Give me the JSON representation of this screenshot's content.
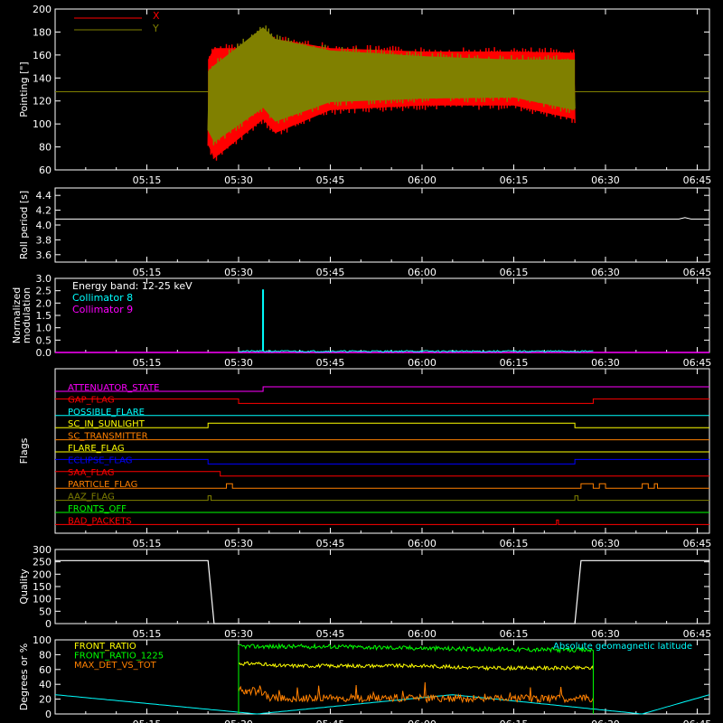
{
  "colors": {
    "background": "#000000",
    "axes": "#ffffff",
    "x": "#ff0000",
    "y": "#808000",
    "roll": "#ffffff",
    "collimator8": "#00ffff",
    "collimator9": "#ff00ff",
    "quality": "#ffffff",
    "front_ratio": "#ffff00",
    "front_ratio_1225": "#00ff00",
    "max_det": "#ff8000",
    "geomag": "#00ffff"
  },
  "time_ticks": [
    "05:15",
    "05:30",
    "05:45",
    "06:00",
    "06:15",
    "06:30",
    "06:45"
  ],
  "chart_data": [
    {
      "id": "pointing",
      "type": "line",
      "ylabel": "Pointing [\"]",
      "ylim": [
        60,
        200
      ],
      "yticks": [
        "60",
        "80",
        "100",
        "120",
        "140",
        "160",
        "180",
        "200"
      ],
      "legend": [
        "X",
        "Y"
      ],
      "series": [
        {
          "name": "X",
          "t": [
            "05:25",
            "05:26",
            "05:34",
            "05:36",
            "05:45",
            "06:00",
            "06:15",
            "06:25"
          ],
          "min": [
            78,
            66,
            100,
            88,
            108,
            112,
            112,
            100
          ],
          "max": [
            160,
            170,
            170,
            178,
            170,
            167,
            167,
            166
          ]
        },
        {
          "name": "Y",
          "t": [
            "05:25",
            "05:26",
            "05:34",
            "05:36",
            "05:45",
            "06:00",
            "06:15",
            "06:25"
          ],
          "min": [
            90,
            80,
            110,
            98,
            115,
            118,
            119,
            108
          ],
          "max": [
            150,
            155,
            188,
            178,
            168,
            163,
            160,
            160
          ]
        },
        {
          "name": "Y baseline",
          "value": 128
        }
      ]
    },
    {
      "id": "roll",
      "type": "line",
      "ylabel": "Roll period [s]",
      "ylim": [
        3.5,
        4.5
      ],
      "yticks": [
        "3.6",
        "3.8",
        "4.0",
        "4.2",
        "4.4"
      ],
      "series": [
        {
          "name": "roll",
          "t": [
            "05:00",
            "06:42",
            "06:43",
            "06:44",
            "06:47"
          ],
          "values": [
            4.08,
            4.08,
            4.1,
            4.08,
            4.08
          ]
        }
      ]
    },
    {
      "id": "modulation",
      "type": "line",
      "ylabel": "Normalized\nmodulation",
      "ylim": [
        0,
        3.0
      ],
      "yticks": [
        "0.0",
        "0.5",
        "1.0",
        "1.5",
        "2.0",
        "2.5",
        "3.0"
      ],
      "legend_title": "Energy band: 12-25 keV",
      "legend": [
        "Collimator 8",
        "Collimator 9"
      ],
      "series": [
        {
          "name": "Collimator 8",
          "t_start": "05:30",
          "t_end": "06:28",
          "level": 0.05,
          "spike_t": "05:34",
          "spike_value": 2.55
        },
        {
          "name": "Collimator 9",
          "t_start": "05:00",
          "t_end": "06:47",
          "level": 0.0
        }
      ]
    },
    {
      "id": "flags",
      "type": "step",
      "ylabel": "Flags",
      "flags": [
        {
          "label": "ATTENUATOR_STATE",
          "color": "#ff00ff",
          "steps": [
            [
              "05:00",
              0
            ],
            [
              "05:34",
              1
            ]
          ]
        },
        {
          "label": "GAP_FLAG",
          "color": "#ff0000",
          "steps": [
            [
              "05:00",
              1
            ],
            [
              "05:30",
              0
            ],
            [
              "06:28",
              1
            ]
          ]
        },
        {
          "label": "POSSIBLE_FLARE",
          "color": "#00ffff",
          "steps": [
            [
              "05:00",
              0
            ]
          ]
        },
        {
          "label": "SC_IN_SUNLIGHT",
          "color": "#ffff00",
          "steps": [
            [
              "05:00",
              0
            ],
            [
              "05:25",
              1
            ],
            [
              "06:25",
              0
            ]
          ]
        },
        {
          "label": "SC_TRANSMITTER",
          "color": "#ff8000",
          "steps": [
            [
              "05:00",
              0
            ]
          ]
        },
        {
          "label": "FLARE_FLAG",
          "color": "#ffff00",
          "steps": [
            [
              "05:00",
              0
            ]
          ]
        },
        {
          "label": "ECLIPSE_FLAG",
          "color": "#0000ff",
          "steps": [
            [
              "05:00",
              1
            ],
            [
              "05:25",
              0
            ],
            [
              "06:25",
              1
            ]
          ]
        },
        {
          "label": "SAA_FLAG",
          "color": "#ff0000",
          "steps": [
            [
              "05:00",
              1
            ],
            [
              "05:27",
              0
            ]
          ]
        },
        {
          "label": "PARTICLE_FLAG",
          "color": "#ff8000",
          "steps": [
            [
              "05:00",
              0
            ],
            [
              "05:28",
              1
            ],
            [
              "05:29",
              0
            ],
            [
              "06:26",
              1
            ],
            [
              "06:28",
              0
            ],
            [
              "06:29",
              1
            ],
            [
              "06:30",
              0
            ],
            [
              "06:36",
              1
            ],
            [
              "06:37",
              0
            ],
            [
              "06:38",
              1
            ],
            [
              "06:38.5",
              0
            ]
          ]
        },
        {
          "label": "AAZ_FLAG",
          "color": "#808000",
          "steps": [
            [
              "05:00",
              0
            ],
            [
              "05:25",
              1
            ],
            [
              "05:25.5",
              0
            ],
            [
              "06:25",
              1
            ],
            [
              "06:25.5",
              0
            ]
          ]
        },
        {
          "label": "FRONTS_OFF",
          "color": "#00ff00",
          "steps": [
            [
              "05:00",
              0
            ]
          ]
        },
        {
          "label": "BAD_PACKETS",
          "color": "#ff0000",
          "steps": [
            [
              "05:00",
              0
            ],
            [
              "06:22",
              1
            ],
            [
              "06:22.3",
              0
            ]
          ]
        }
      ]
    },
    {
      "id": "quality",
      "type": "line",
      "ylabel": "Quality",
      "ylim": [
        0,
        300
      ],
      "yticks": [
        "0",
        "50",
        "100",
        "150",
        "200",
        "250",
        "300"
      ],
      "series": [
        {
          "name": "Quality",
          "t": [
            "05:00",
            "05:25",
            "05:26",
            "06:25",
            "06:26",
            "06:47"
          ],
          "values": [
            255,
            255,
            0,
            0,
            255,
            255
          ]
        }
      ]
    },
    {
      "id": "ratios",
      "type": "line",
      "ylabel": "Degrees or %",
      "ylim": [
        0,
        100
      ],
      "yticks": [
        "0",
        "20",
        "40",
        "60",
        "80",
        "100"
      ],
      "legend": [
        "FRONT_RATIO",
        "FRONT_RATIO_1225",
        "MAX_DET_VS_TOT"
      ],
      "annotation": "Absolute geomagnetic latitude",
      "series": [
        {
          "name": "FRONT_RATIO",
          "t": [
            "05:30",
            "05:34",
            "05:35",
            "06:00",
            "06:10",
            "06:28"
          ],
          "values": [
            68,
            68,
            65,
            65,
            62,
            62
          ]
        },
        {
          "name": "FRONT_RATIO_1225",
          "t": [
            "05:30",
            "05:45",
            "06:05",
            "06:28"
          ],
          "values": [
            91,
            91,
            88,
            86
          ]
        },
        {
          "name": "MAX_DET_VS_TOT",
          "t": [
            "05:30",
            "05:34",
            "05:35",
            "06:28"
          ],
          "values": [
            32,
            30,
            21,
            21
          ]
        },
        {
          "name": "Absolute geomagnetic latitude",
          "t": [
            "05:00",
            "05:33",
            "06:05",
            "06:36",
            "06:47"
          ],
          "values": [
            26,
            0,
            26,
            0,
            26
          ]
        }
      ]
    }
  ]
}
